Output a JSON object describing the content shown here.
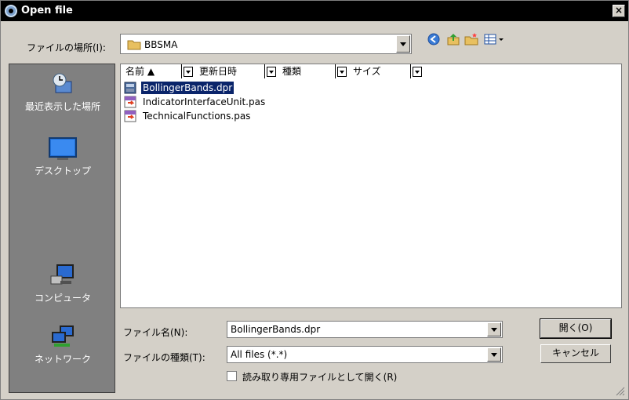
{
  "window": {
    "title": "Open file",
    "close_label": "×"
  },
  "lookin": {
    "label": "ファイルの場所(I):",
    "value": "BBSMA"
  },
  "places": [
    {
      "label": "最近表示した場所",
      "icon": "recent-places-icon"
    },
    {
      "label": "デスクトップ",
      "icon": "desktop-icon"
    },
    {
      "label": "コンピュータ",
      "icon": "computer-icon"
    },
    {
      "label": "ネットワーク",
      "icon": "network-icon"
    }
  ],
  "columns": [
    {
      "label": "名前 ▲"
    },
    {
      "label": "更新日時"
    },
    {
      "label": "種類"
    },
    {
      "label": "サイズ"
    }
  ],
  "files": [
    {
      "name": "BollingerBands.dpr",
      "icon": "delphi-project-icon",
      "selected": true
    },
    {
      "name": "IndicatorInterfaceUnit.pas",
      "icon": "pascal-file-icon",
      "selected": false
    },
    {
      "name": "TechnicalFunctions.pas",
      "icon": "pascal-file-icon",
      "selected": false
    }
  ],
  "filename": {
    "label": "ファイル名(N):",
    "value": "BollingerBands.dpr"
  },
  "filetype": {
    "label": "ファイルの種類(T):",
    "value": "All files (*.*)"
  },
  "readonly": {
    "label": "読み取り専用ファイルとして開く(R)",
    "checked": false
  },
  "buttons": {
    "open": "開く(O)",
    "cancel": "キャンセル"
  },
  "colors": {
    "selection": "#0a246a",
    "places_bg": "#808080",
    "dialog_bg": "#d4d0c8"
  }
}
